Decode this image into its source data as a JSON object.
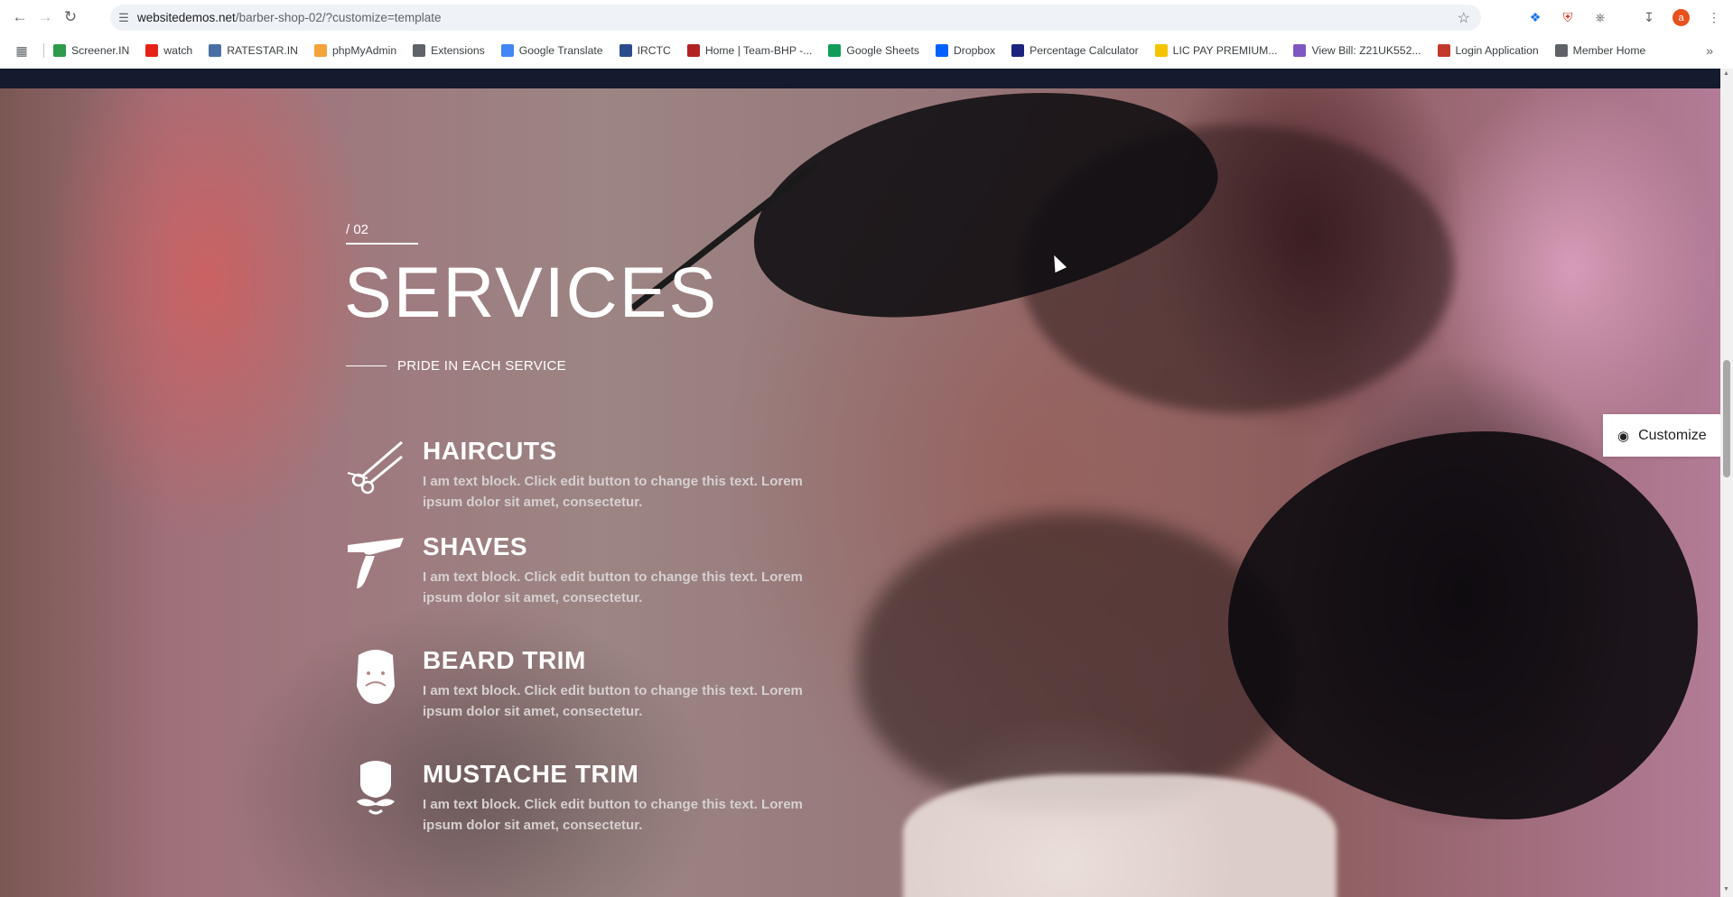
{
  "browser": {
    "url_host": "websitedemos.net",
    "url_path": "/barber-shop-02/?customize=template",
    "avatar_letter": "a",
    "bookmarks": [
      {
        "label": "Screener.IN",
        "icon": "bar-chart-icon",
        "color": "#2e9a4b"
      },
      {
        "label": "watch",
        "icon": "youtube-icon",
        "color": "#e62117"
      },
      {
        "label": "RATESTAR.IN",
        "icon": "ratestar-icon",
        "color": "#4a6fa5"
      },
      {
        "label": "phpMyAdmin",
        "icon": "phpmyadmin-icon",
        "color": "#f2a33a"
      },
      {
        "label": "Extensions",
        "icon": "puzzle-icon",
        "color": "#5f6368"
      },
      {
        "label": "Google Translate",
        "icon": "translate-icon",
        "color": "#4285f4"
      },
      {
        "label": "IRCTC",
        "icon": "irctc-icon",
        "color": "#2b4c8c"
      },
      {
        "label": "Home | Team-BHP -...",
        "icon": "teambhp-icon",
        "color": "#b22222"
      },
      {
        "label": "Google Sheets",
        "icon": "sheets-icon",
        "color": "#0f9d58"
      },
      {
        "label": "Dropbox",
        "icon": "dropbox-icon",
        "color": "#0061fe"
      },
      {
        "label": "Percentage Calculator",
        "icon": "percent-icon",
        "color": "#1a237e"
      },
      {
        "label": "LIC PAY PREMIUM...",
        "icon": "lic-icon",
        "color": "#f5c400"
      },
      {
        "label": "View Bill: Z21UK552...",
        "icon": "bill-icon",
        "color": "#7e57c2"
      },
      {
        "label": "Login Application",
        "icon": "login-icon",
        "color": "#c0392b"
      },
      {
        "label": "Member Home",
        "icon": "globe-icon",
        "color": "#5f6368"
      }
    ]
  },
  "section": {
    "kicker": "/ 02",
    "title": "SERVICES",
    "subtitle": "PRIDE IN EACH SERVICE"
  },
  "services": [
    {
      "name": "HAIRCUTS",
      "icon": "scissors-icon",
      "text": "I am text block. Click edit button to change this text. Lorem ipsum dolor sit amet, consectetur."
    },
    {
      "name": "SHAVES",
      "icon": "razor-icon",
      "text": "I am text block. Click edit button to change this text. Lorem ipsum dolor sit amet, consectetur."
    },
    {
      "name": "BEARD TRIM",
      "icon": "beard-icon",
      "text": "I am text block. Click edit button to change this text. Lorem ipsum dolor sit amet, consectetur."
    },
    {
      "name": "MUSTACHE TRIM",
      "icon": "mustache-icon",
      "text": "I am text block. Click edit button to change this text. Lorem ipsum dolor sit amet, consectetur."
    }
  ],
  "customize_label": "Customize"
}
